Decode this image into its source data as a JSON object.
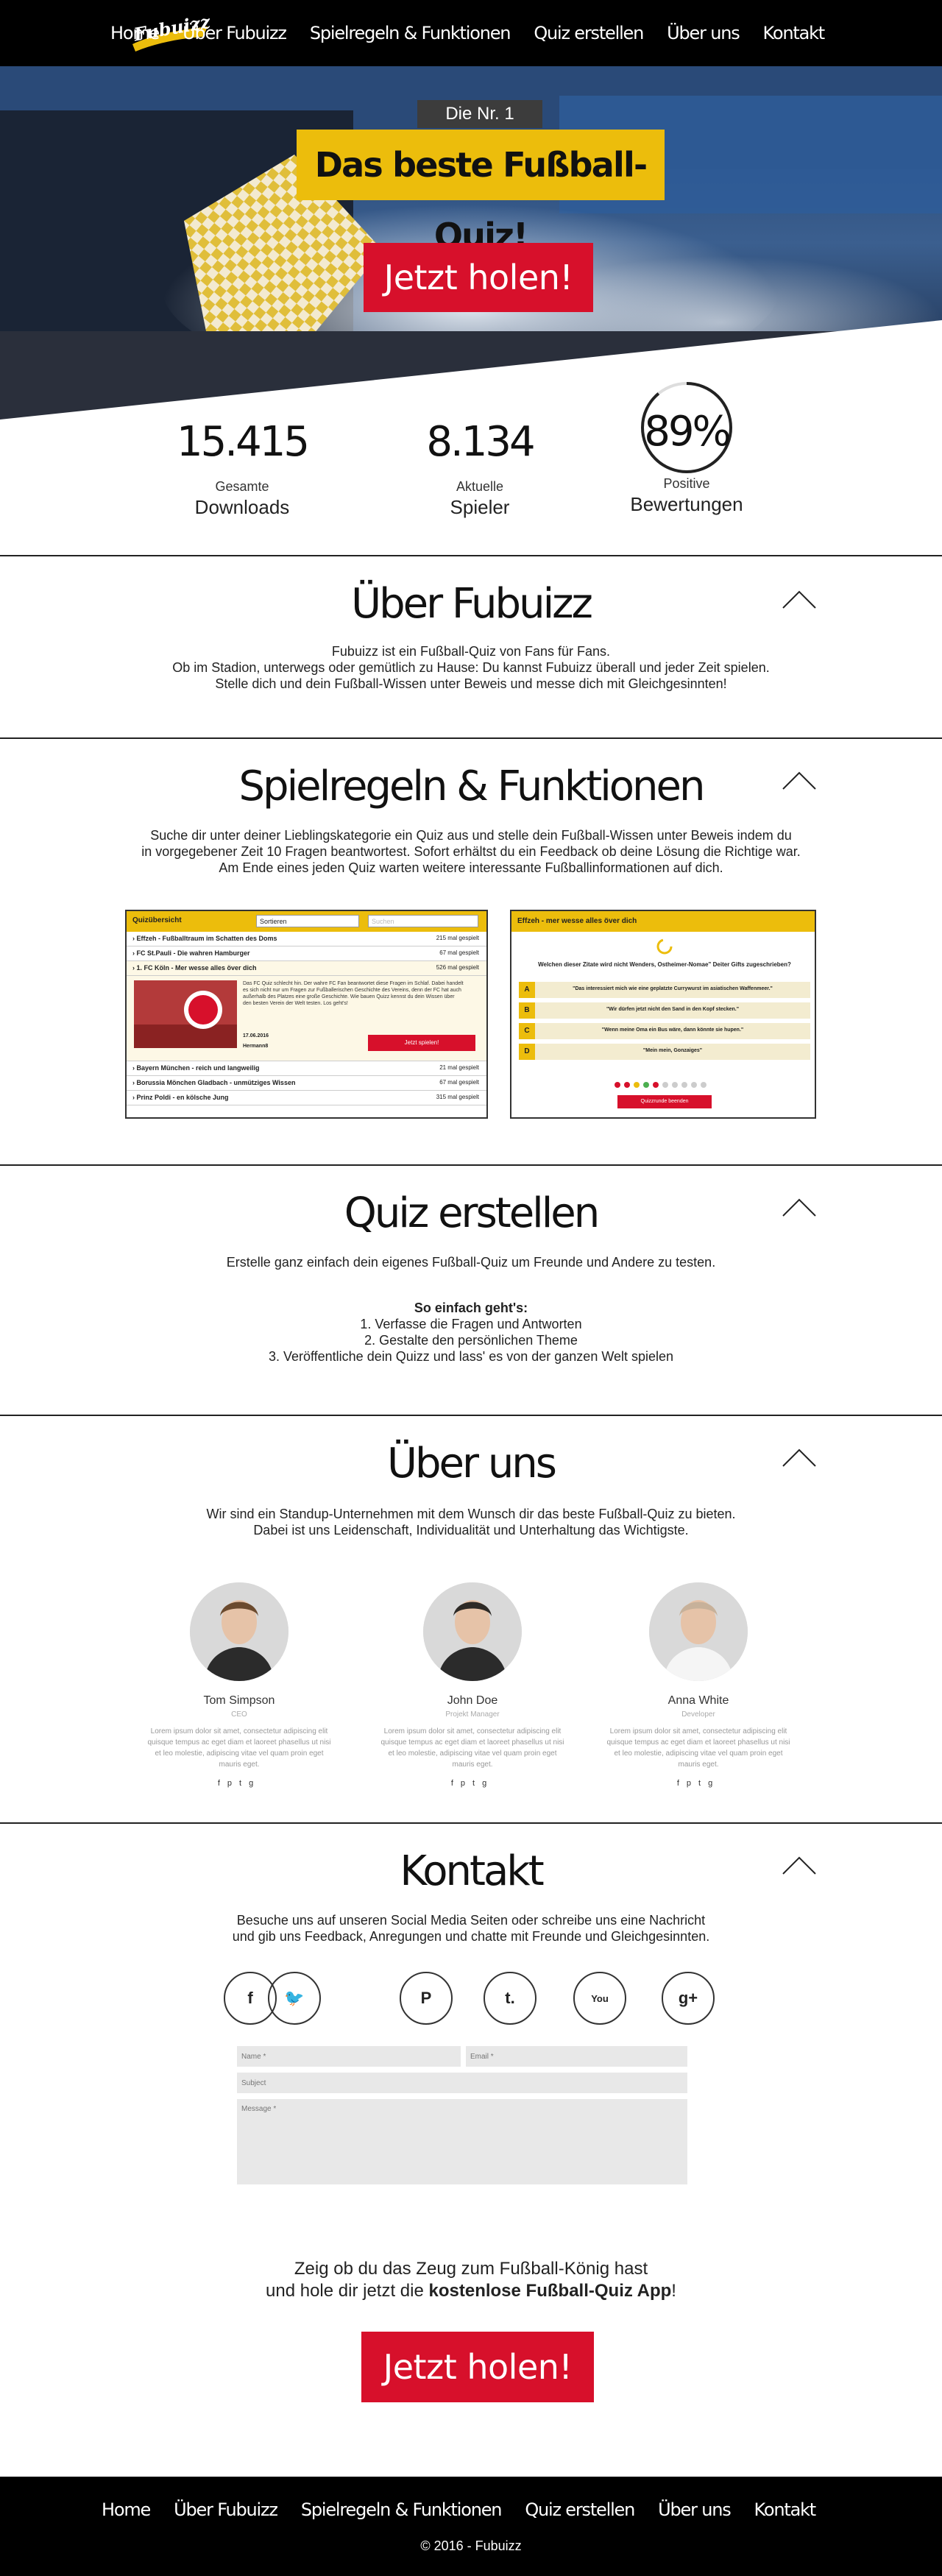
{
  "nav": {
    "items": [
      "Home",
      "Über Fubuizz",
      "Spielregeln & Funktionen",
      "Quiz erstellen",
      "Über uns",
      "Kontakt"
    ],
    "logo_text": "Fubuizz"
  },
  "hero": {
    "badge_small": "Die Nr. 1",
    "badge_big": "Das beste Fußball-Quiz!",
    "cta": "Jetzt holen!"
  },
  "stats": [
    {
      "value": "15.415",
      "label1": "Gesamte",
      "label2": "Downloads"
    },
    {
      "value": "8.134",
      "label1": "Aktuelle",
      "label2": "Spieler"
    },
    {
      "value": "89%",
      "label1": "Positive",
      "label2": "Bewertungen",
      "percent": 89
    }
  ],
  "about": {
    "title": "Über Fubuizz",
    "lines": [
      "Fubuizz ist ein Fußball-Quiz von Fans für Fans.",
      "Ob im Stadion, unterwegs oder gemütlich zu Hause: Du kannst Fubuizz überall und jeder Zeit spielen.",
      "Stelle dich und dein Fußball-Wissen unter Beweis und messe dich mit Gleichgesinnten!"
    ]
  },
  "rules": {
    "title": "Spielregeln & Funktionen",
    "lines": [
      "Suche dir unter deiner Lieblingskategorie ein Quiz aus und stelle dein Fußball-Wissen unter Beweis indem du",
      "in vorgegebener Zeit 10 Fragen beantwortest. Sofort erhältst du ein Feedback ob deine Lösung die Richtige war.",
      "Am Ende eines jeden Quiz warten weitere interessante Fußballinformationen auf dich."
    ],
    "shot1": {
      "header": "Quizübersicht",
      "sort": "Sortieren",
      "search": "Suchen",
      "rows": [
        {
          "title": "Effzeh - Fußballtraum im Schatten des Doms",
          "count": "215 mal gespielt"
        },
        {
          "title": "FC St.Pauli - Die wahren Hamburger",
          "count": "67 mal gespielt"
        },
        {
          "title": "1. FC Köln - Mer wesse alles över dich",
          "count": "526 mal gespielt"
        },
        {
          "title": "Bayern München - reich und langweilig",
          "count": "21 mal gespielt"
        },
        {
          "title": "Borussia Mönchen Gladbach - unmütziges Wissen",
          "count": "67 mal gespielt"
        },
        {
          "title": "Prinz Poldi - en kölsche Jung",
          "count": "315 mal gespielt"
        }
      ],
      "detail_text": "Das FC Quiz schlecht hin. Der wahre FC Fan beantwortet diese Fragen im Schlaf. Dabei handelt es sich nicht nur um Fragen zur Fußballerischen Geschichte des Vereins, denn der FC hat auch außerhalb des Platzes eine große Geschichte. Wie bauen Quizz kennst du dein Wissen über den besten Verein der Welt testen. Los geht's!",
      "detail_date": "17.06.2016",
      "detail_author": "Hermann8",
      "detail_btn": "Jetzt spielen!"
    },
    "shot2": {
      "header": "Effzeh - mer wesse alles över dich",
      "question": "Welchen dieser Zitate wird nicht Wenders, Ostheimer-Nomae” Deiter Gifts zugeschrieben?",
      "answers": [
        {
          "letter": "A",
          "text": "\"Das interessiert mich wie eine geplatzte Currywurst im asiatischen Waffenmeer.\""
        },
        {
          "letter": "B",
          "text": "\"Wir dürfen jetzt nicht den Sand in den Kopf stecken.\""
        },
        {
          "letter": "C",
          "text": "\"Wenn meine Oma ein Bus wäre, dann könnte sie hupen.\""
        },
        {
          "letter": "D",
          "text": "\"Mein mein, Gonzaiges\""
        }
      ],
      "btn": "Quizzrunde beenden"
    }
  },
  "create": {
    "title": "Quiz erstellen",
    "intro": "Erstelle ganz einfach dein eigenes Fußball-Quiz um Freunde und Andere zu testen.",
    "how": "So einfach geht's:",
    "steps": [
      "1. Verfasse die Fragen und Antworten",
      "2. Gestalte den persönlichen Theme",
      "3. Veröffentliche dein Quizz und lass' es von der ganzen Welt spielen"
    ]
  },
  "team": {
    "title": "Über uns",
    "lines": [
      "Wir sind ein Standup-Unternehmen mit dem Wunsch dir das beste Fußball-Quiz zu bieten.",
      "Dabei ist uns Leidenschaft, Individualität und Unterhaltung das Wichtigste."
    ],
    "members": [
      {
        "name": "Tom Simpson",
        "role": "CEO",
        "desc": "Lorem ipsum dolor sit amet, consectetur adipiscing elit quisque tempus ac eget diam et laoreet phasellus ut nisi et leo molestie, adipiscing vitae vel quam proin eget mauris eget."
      },
      {
        "name": "John Doe",
        "role": "Projekt Manager",
        "desc": "Lorem ipsum dolor sit amet, consectetur adipiscing elit quisque tempus ac eget diam et laoreet phasellus ut nisi et leo molestie, adipiscing vitae vel quam proin eget mauris eget."
      },
      {
        "name": "Anna White",
        "role": "Developer",
        "desc": "Lorem ipsum dolor sit amet, consectetur adipiscing elit quisque tempus ac eget diam et laoreet phasellus ut nisi et leo molestie, adipiscing vitae vel quam proin eget mauris eget."
      }
    ]
  },
  "contact": {
    "title": "Kontakt",
    "lines": [
      "Besuche uns auf unseren Social Media Seiten oder schreibe uns eine Nachricht",
      "und gib uns Feedback, Anregungen und chatte mit Freunde und Gleichgesinnten."
    ],
    "social": [
      "facebook-icon",
      "twitter-icon",
      "pinterest-icon",
      "tumblr-icon",
      "youtube-icon",
      "google-plus-icon"
    ],
    "form": {
      "name": "Name *",
      "email": "Email *",
      "subject": "Subject",
      "message": "Message *"
    }
  },
  "closing": {
    "line1": "Zeig ob du das Zeug zum Fußball-König hast",
    "line2_pre": "und hole dir jetzt die ",
    "line2_bold": "kostenlose Fußball-Quiz App",
    "line2_post": "!",
    "cta": "Jetzt holen!"
  },
  "footer": {
    "copyright": "© 2016 - Fubuizz"
  },
  "colors": {
    "accent_yellow": "#ecbd0c",
    "cta_red": "#d7102b"
  }
}
